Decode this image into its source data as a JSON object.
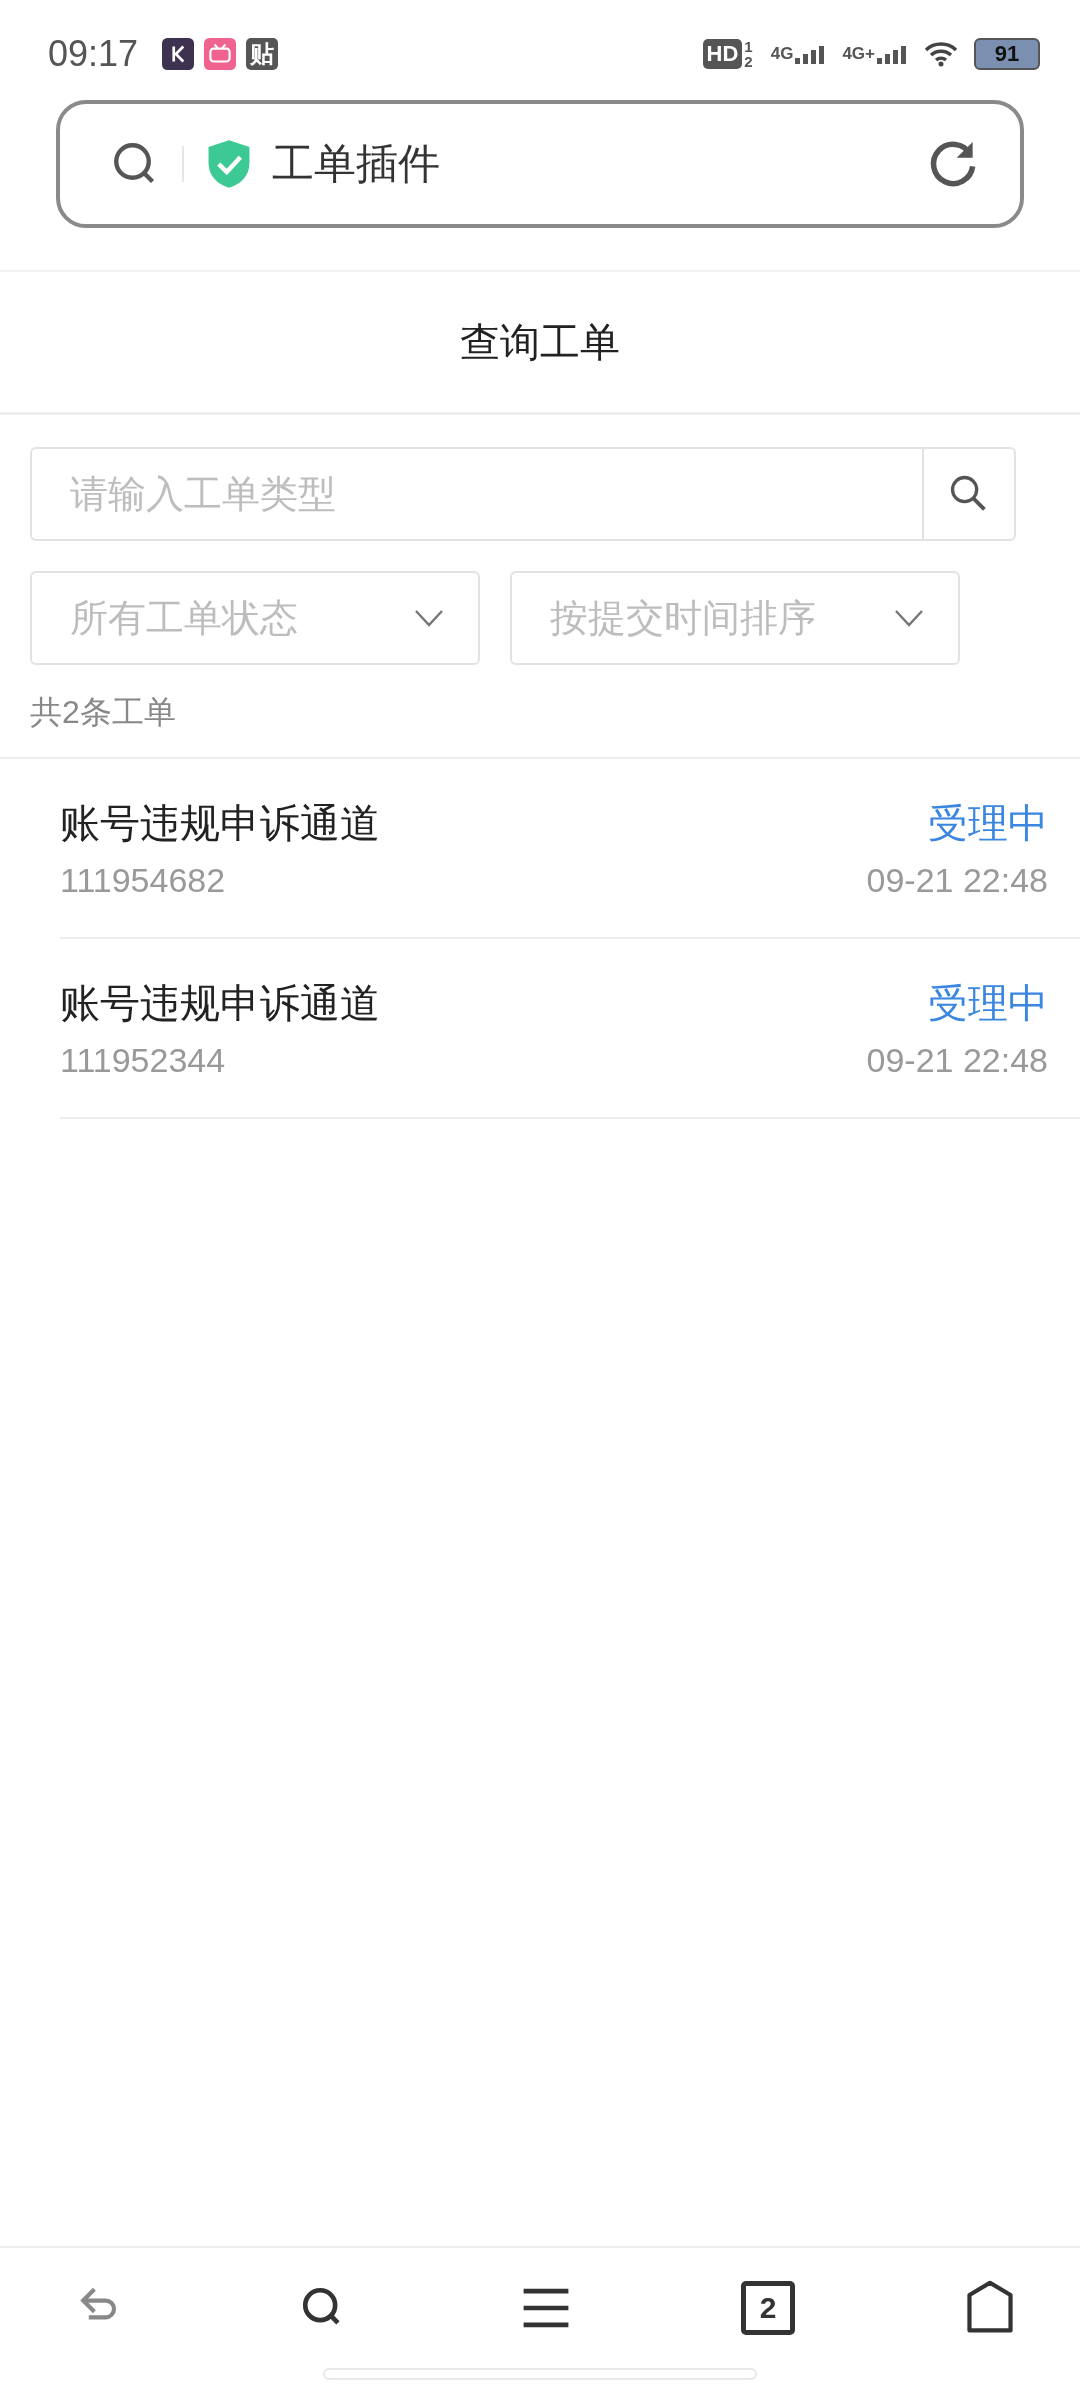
{
  "status_bar": {
    "time": "09:17",
    "notification_icons": [
      {
        "kind": "app"
      },
      {
        "kind": "video"
      },
      {
        "kind": "text",
        "label": "贴"
      }
    ],
    "hd": "HD",
    "sims": [
      "1",
      "2"
    ],
    "signals": [
      "4G",
      "4G+"
    ],
    "battery": "91"
  },
  "address_bar": {
    "title": "工单插件"
  },
  "page_title": "查询工单",
  "search": {
    "placeholder": "请输入工单类型"
  },
  "filters": [
    {
      "placeholder": "所有工单状态"
    },
    {
      "placeholder": "按提交时间排序"
    }
  ],
  "count": "共2条工单",
  "tickets": [
    {
      "title": "账号违规申诉通道",
      "id": "111954682",
      "status": "受理中",
      "time": "09-21 22:48"
    },
    {
      "title": "账号违规申诉通道",
      "id": "111952344",
      "status": "受理中",
      "time": "09-21 22:48"
    }
  ],
  "bottom_nav": {
    "tab_count": "2"
  }
}
